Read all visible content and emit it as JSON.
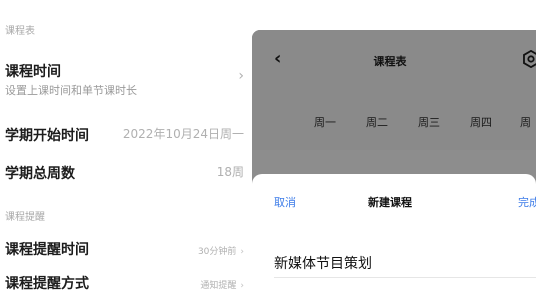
{
  "settings": {
    "section_course": "课程表",
    "class_time": {
      "title": "课程时间",
      "subtitle": "设置上课时间和单节课时长",
      "chevron": "›"
    },
    "term_start": {
      "title": "学期开始时间",
      "value": "2022年10月24日周一"
    },
    "term_weeks": {
      "title": "学期总周数",
      "value": "18周"
    },
    "section_reminder": "课程提醒",
    "reminder_time": {
      "title": "课程提醒时间",
      "value": "30分钟前",
      "chevron": "›"
    },
    "reminder_method": {
      "title": "课程提醒方式",
      "value": "通知提醒",
      "chevron": "›"
    }
  },
  "phone": {
    "back_icon": "‹",
    "title": "课程表",
    "settings_icon": "gear-icon",
    "weekdays": [
      "周一",
      "周二",
      "周三",
      "周四",
      "周"
    ],
    "sheet": {
      "cancel": "取消",
      "title": "新建课程",
      "done": "完成",
      "course_name": "新媒体节目策划"
    }
  },
  "colors": {
    "accent": "#3b7be8",
    "overlay": "#8d8d8d"
  }
}
